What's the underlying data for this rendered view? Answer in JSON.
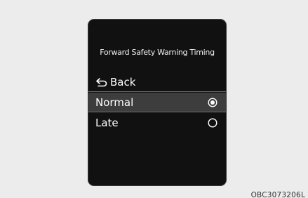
{
  "screen": {
    "title": "Forward Safety Warning Timing",
    "back_label": "Back",
    "options": [
      {
        "label": "Normal",
        "selected": true
      },
      {
        "label": "Late",
        "selected": false
      }
    ]
  },
  "caption": "OBC3073206L",
  "icons": {
    "back": "back-arrow-icon",
    "radio_selected": "radio-selected-icon",
    "radio_unselected": "radio-unselected-icon"
  }
}
